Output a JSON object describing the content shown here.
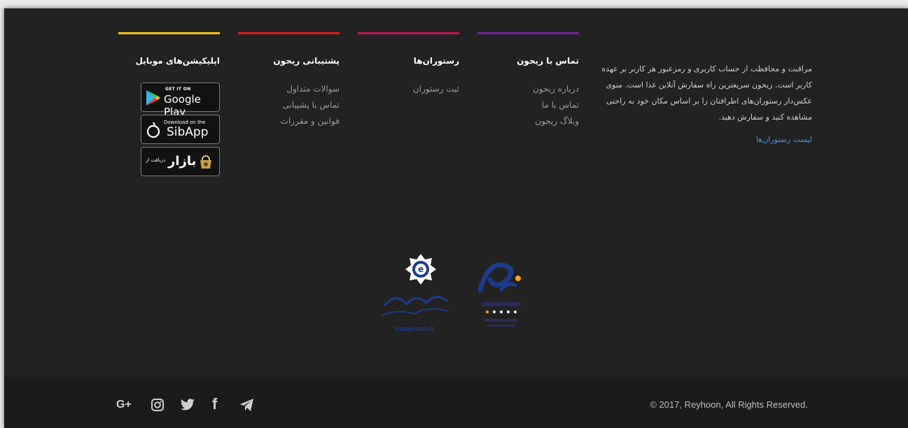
{
  "colors": {
    "bar_apps": "#f5c518",
    "bar_support": "#e21b1b",
    "bar_restaurants": "#c2185b",
    "bar_contact": "#7b1fa2",
    "link": "#4a90e2"
  },
  "about": {
    "text": "مراقبت و محافظت از حساب کاربری و رمزعبور هر کاربر بر عهده کاربر است. ریحون سریعترین راه سفارش آنلاین غذا است. منوی عکس‌دار رستوران‌های اطرافتان را بر اساس مکان خود به راحتی مشاهده کنید و سفارش دهید.",
    "link_label": "لیست رستوران‌ها"
  },
  "columns": {
    "contact": {
      "title": "تماس با ریحون",
      "items": [
        "درباره ریحون",
        "تماس با ما",
        "وبلاگ ریحون"
      ]
    },
    "restaurants": {
      "title": "رستوران‌ها",
      "items": [
        "ثبت رستوران"
      ]
    },
    "support": {
      "title": "پشتیبانی ریحون",
      "items": [
        "سوالات متداول",
        "تماس با پشیبانی",
        "قوانین و مقررات"
      ]
    },
    "apps": {
      "title": "اپلیکیشن‌های موبایل"
    }
  },
  "apps": {
    "google_play": {
      "small": "GET IT ON",
      "big": "Google Play",
      "icon": "google-play-icon"
    },
    "sibapp": {
      "small": "Download on the",
      "big": "SibApp",
      "icon": "sibapp-icon"
    },
    "bazaar": {
      "small": "دریافت از",
      "big": "بازار",
      "icon": "bazaar-bag-icon"
    }
  },
  "badges": {
    "anjoman": {
      "caption": "eanjoman.ir",
      "icon": "anjoman-seal-icon"
    },
    "enamad": {
      "icon": "enamad-seal-icon"
    }
  },
  "bottom": {
    "copyright": "© 2017, Reyhoon, All Rights Reserved.",
    "social": [
      {
        "name": "google-plus",
        "glyph": "G+"
      },
      {
        "name": "instagram"
      },
      {
        "name": "twitter"
      },
      {
        "name": "facebook",
        "glyph": "f"
      },
      {
        "name": "telegram"
      }
    ]
  }
}
